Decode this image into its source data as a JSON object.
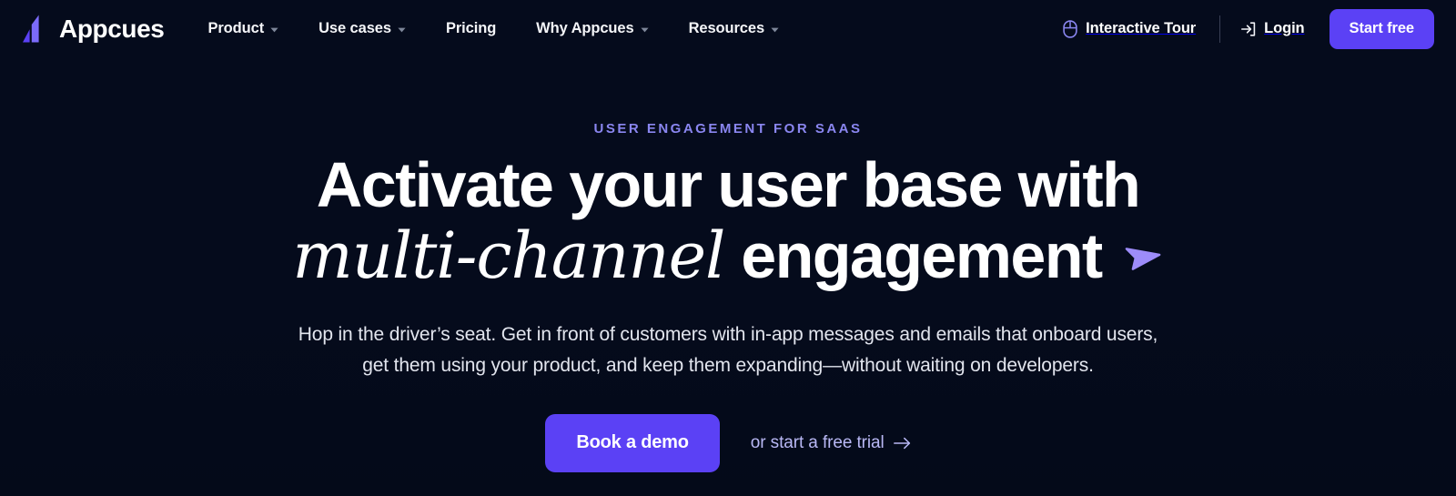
{
  "brand": {
    "name": "Appcues",
    "logo_icon": "appcues-logo-mark",
    "accent_color": "#5B41F5"
  },
  "nav": {
    "items": [
      {
        "label": "Product",
        "has_dropdown": true,
        "caret_icon": "chevron-down-icon"
      },
      {
        "label": "Use cases",
        "has_dropdown": true,
        "caret_icon": "chevron-down-icon"
      },
      {
        "label": "Pricing",
        "has_dropdown": false,
        "caret_icon": ""
      },
      {
        "label": "Why Appcues",
        "has_dropdown": true,
        "caret_icon": "chevron-down-icon"
      },
      {
        "label": "Resources",
        "has_dropdown": true,
        "caret_icon": "chevron-down-icon"
      }
    ],
    "interactive_tour": {
      "label": "Interactive Tour",
      "icon": "mouse-icon",
      "icon_color": "#8A86F0"
    },
    "login": {
      "label": "Login",
      "icon": "login-arrow-icon"
    },
    "start_free": {
      "label": "Start free",
      "background": "#5B41F5",
      "text_color": "#FFFFFF"
    }
  },
  "hero": {
    "eyebrow": "USER ENGAGEMENT FOR SAAS",
    "eyebrow_color": "#8A86F0",
    "headline_line1": "Activate your user base with",
    "headline_accent": "multi-channel",
    "headline_line2_rest": "engagement",
    "cursor_icon": "cursor-pointer-icon",
    "cursor_color": "#9D8CFA",
    "subhead_line1": "Hop in the driver’s seat. Get in front of customers with in-app messages and emails that onboard",
    "subhead_line2": "users, get them using your product, and keep them expanding—without waiting on developers.",
    "primary_cta": {
      "label": "Book a demo",
      "background": "#5B41F5",
      "text_color": "#FFFFFF"
    },
    "secondary_cta": {
      "label": "or start a free trial",
      "arrow_icon": "arrow-right-icon",
      "text_color": "#B9B8F5"
    }
  },
  "page": {
    "background": "#050B1C"
  }
}
